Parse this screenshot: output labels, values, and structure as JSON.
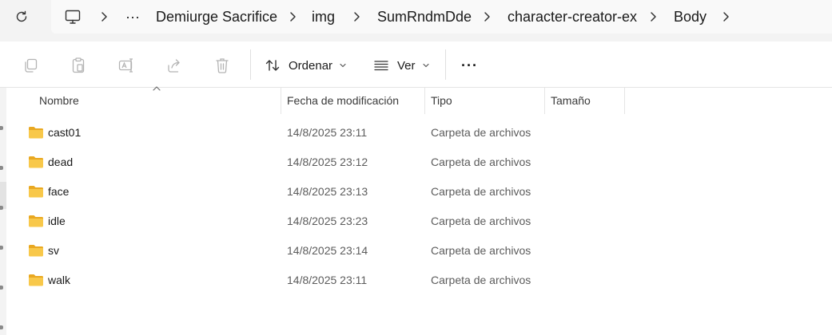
{
  "address_bar": {
    "ellipsis": "···",
    "breadcrumbs": [
      "Demiurge Sacrifice",
      "img",
      "SumRndmDde",
      "character-creator-ex",
      "Body"
    ]
  },
  "toolbar": {
    "sort_label": "Ordenar",
    "view_label": "Ver",
    "more_label": "···"
  },
  "columns": {
    "name": "Nombre",
    "modified": "Fecha de modificación",
    "type": "Tipo",
    "size": "Tamaño"
  },
  "files": [
    {
      "name": "cast01",
      "modified": "14/8/2025 23:11",
      "type": "Carpeta de archivos",
      "size": ""
    },
    {
      "name": "dead",
      "modified": "14/8/2025 23:12",
      "type": "Carpeta de archivos",
      "size": ""
    },
    {
      "name": "face",
      "modified": "14/8/2025 23:13",
      "type": "Carpeta de archivos",
      "size": ""
    },
    {
      "name": "idle",
      "modified": "14/8/2025 23:23",
      "type": "Carpeta de archivos",
      "size": ""
    },
    {
      "name": "sv",
      "modified": "14/8/2025 23:14",
      "type": "Carpeta de archivos",
      "size": ""
    },
    {
      "name": "walk",
      "modified": "14/8/2025 23:11",
      "type": "Carpeta de archivos",
      "size": ""
    }
  ],
  "icons": {
    "refresh": "refresh-icon",
    "computer": "computer-icon",
    "copy": "copy-icon",
    "paste": "paste-icon",
    "rename": "rename-icon",
    "share": "share-icon",
    "delete": "delete-icon",
    "sort": "sort-icon",
    "view": "view-icon",
    "folder": "folder-icon"
  },
  "colors": {
    "folder_body": "#f8c84a",
    "folder_tab": "#e9a821",
    "toolbar_disabled": "#b3b3b3",
    "header_bg": "#f3f3f3"
  }
}
